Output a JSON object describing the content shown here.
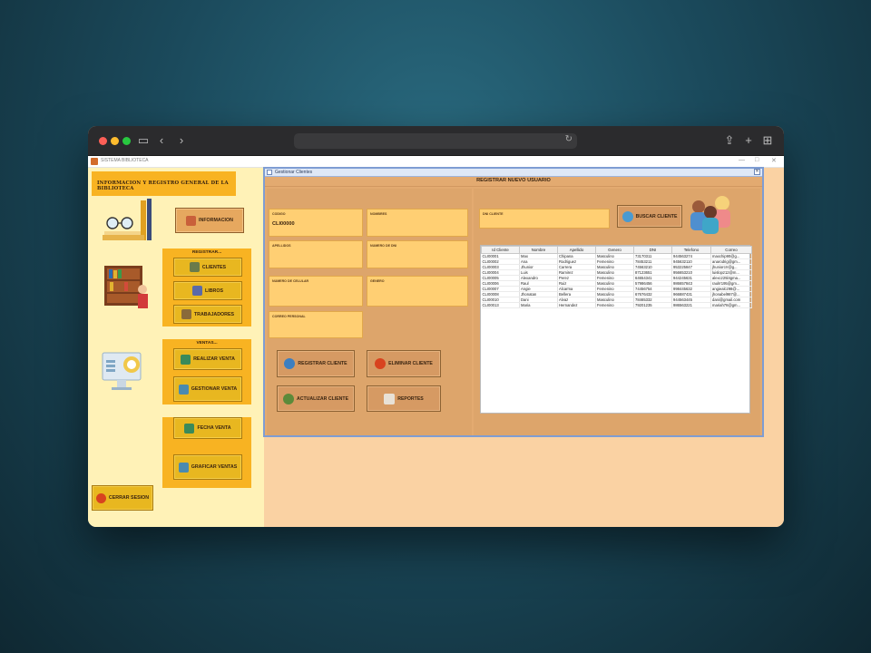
{
  "app": {
    "window_title": "SISTEMA BIBLIOTECA",
    "sidebar_header": "INFORMACION Y REGISTRO GENERAL DE LA BIBLIOTECA",
    "info_button": "INFORMACION",
    "groups": {
      "registrar": {
        "title": "REGISTRAR...",
        "buttons": [
          "CLIENTES",
          "LIBROS",
          "TRABAJADORES"
        ]
      },
      "ventas": {
        "title": "VENTAS...",
        "buttons": [
          "REALIZAR VENTA",
          "GESTIONAR VENTA"
        ]
      },
      "graficas": {
        "title": "GRAFICAS...",
        "buttons": [
          "FECHA VENTA",
          "GRAFICAR VENTAS"
        ]
      }
    },
    "logout_button": "CERRAR SESION"
  },
  "dialog": {
    "title": "Gestionar Clientes",
    "form_title": "REGISTRAR NUEVO USUARIO",
    "fields": {
      "codigo": {
        "label": "CODIGO",
        "value": "CLI00000"
      },
      "nombres": {
        "label": "NOMBRES",
        "value": ""
      },
      "apellidos": {
        "label": "APELLIDOS",
        "value": ""
      },
      "dni": {
        "label": "NUMERO DE DNI",
        "value": ""
      },
      "celular": {
        "label": "NUMERO DE CELULAR",
        "value": ""
      },
      "genero": {
        "label": "GENERO",
        "value": ""
      },
      "correo": {
        "label": "CORREO PERSONAL",
        "value": ""
      },
      "dni_cliente": {
        "label": "DNI CLIENTE",
        "value": ""
      }
    },
    "buttons": {
      "registrar": "REGISTRAR CLIENTE",
      "eliminar": "ELIMINAR CLIENTE",
      "actualizar": "ACTUALIZAR CLIENTE",
      "reportes": "REPORTES",
      "buscar": "BUSCAR CLIENTE"
    },
    "table": {
      "columns": [
        "Id Cliente",
        "Nombre",
        "Apellido",
        "Genero",
        "DNI",
        "Telefono",
        "Correo"
      ],
      "rows": [
        [
          "CLI00001",
          "Max",
          "Chipana",
          "Masculino",
          "73170311",
          "944563274",
          "maxchip90@g..."
        ],
        [
          "CLI00002",
          "Ana",
          "Rodriguez",
          "Femenino",
          "78453211",
          "945632110",
          "anarodrig@gm..."
        ],
        [
          "CLI00003",
          "Jhunior",
          "Carrera",
          "Masculino",
          "74563210",
          "953225847",
          "jhuniorcrr@g..."
        ],
        [
          "CLI00004",
          "Luis",
          "Ramirez",
          "Masculino",
          "87123651",
          "956653210",
          "luislopz12@m..."
        ],
        [
          "CLI00005",
          "Alexandro",
          "Perez",
          "Femenino",
          "64654341",
          "944245631",
          "alexcz25l4gma..."
        ],
        [
          "CLI00006",
          "Raul",
          "Ruiz",
          "Masculino",
          "57986456",
          "986657843",
          "raulrr195@gm..."
        ],
        [
          "CLI00007",
          "Angie",
          "Alcarma",
          "Femenino",
          "74456754",
          "998445632",
          "angiealcz98@..."
        ],
        [
          "CLI00008",
          "Jhonatan",
          "Bellera",
          "Masculino",
          "67676432",
          "966887431",
          "jhonabel987@..."
        ],
        [
          "CLI00010",
          "Dani",
          "Alvaz",
          "Masculino",
          "78465332",
          "944563445",
          "dani@gmail.com"
        ],
        [
          "CLI00013",
          "Maria",
          "Hernandez",
          "Femenino",
          "79201235",
          "986563221",
          "mariah78@gm..."
        ]
      ]
    }
  }
}
